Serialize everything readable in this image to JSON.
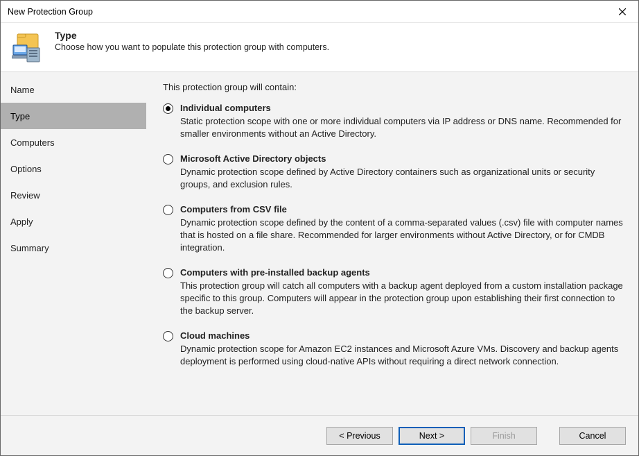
{
  "window": {
    "title": "New Protection Group"
  },
  "header": {
    "heading": "Type",
    "subheading": "Choose how you want to populate this protection group with computers."
  },
  "sidebar": {
    "steps": [
      {
        "label": "Name",
        "active": false
      },
      {
        "label": "Type",
        "active": true
      },
      {
        "label": "Computers",
        "active": false
      },
      {
        "label": "Options",
        "active": false
      },
      {
        "label": "Review",
        "active": false
      },
      {
        "label": "Apply",
        "active": false
      },
      {
        "label": "Summary",
        "active": false
      }
    ]
  },
  "content": {
    "intro": "This protection group will contain:",
    "options": [
      {
        "id": "individual-computers",
        "checked": true,
        "label": "Individual computers",
        "desc": "Static protection scope with one or more individual computers via IP address or DNS name. Recommended for smaller environments without an Active Directory."
      },
      {
        "id": "ad-objects",
        "checked": false,
        "label": "Microsoft Active Directory objects",
        "desc": "Dynamic protection scope defined by Active Directory containers such as organizational units or security groups, and exclusion rules."
      },
      {
        "id": "csv-file",
        "checked": false,
        "label": "Computers from CSV file",
        "desc": "Dynamic protection scope defined by the content of a comma-separated values (.csv) file with computer names that is hosted on a file share. Recommended for larger environments without Active Directory, or for CMDB integration."
      },
      {
        "id": "preinstalled-agents",
        "checked": false,
        "label": "Computers with pre-installed backup agents",
        "desc": "This protection group will catch all computers with a backup agent deployed from a custom installation package specific to this group.  Computers will appear in the protection group upon establishing their first connection to the backup server."
      },
      {
        "id": "cloud-machines",
        "checked": false,
        "label": "Cloud machines",
        "desc": "Dynamic protection scope for Amazon EC2 instances and Microsoft Azure VMs. Discovery and backup agents deployment is performed using cloud-native APIs without requiring a direct network connection."
      }
    ]
  },
  "footer": {
    "previous": "< Previous",
    "next": "Next >",
    "finish": "Finish",
    "cancel": "Cancel",
    "finish_enabled": false
  }
}
